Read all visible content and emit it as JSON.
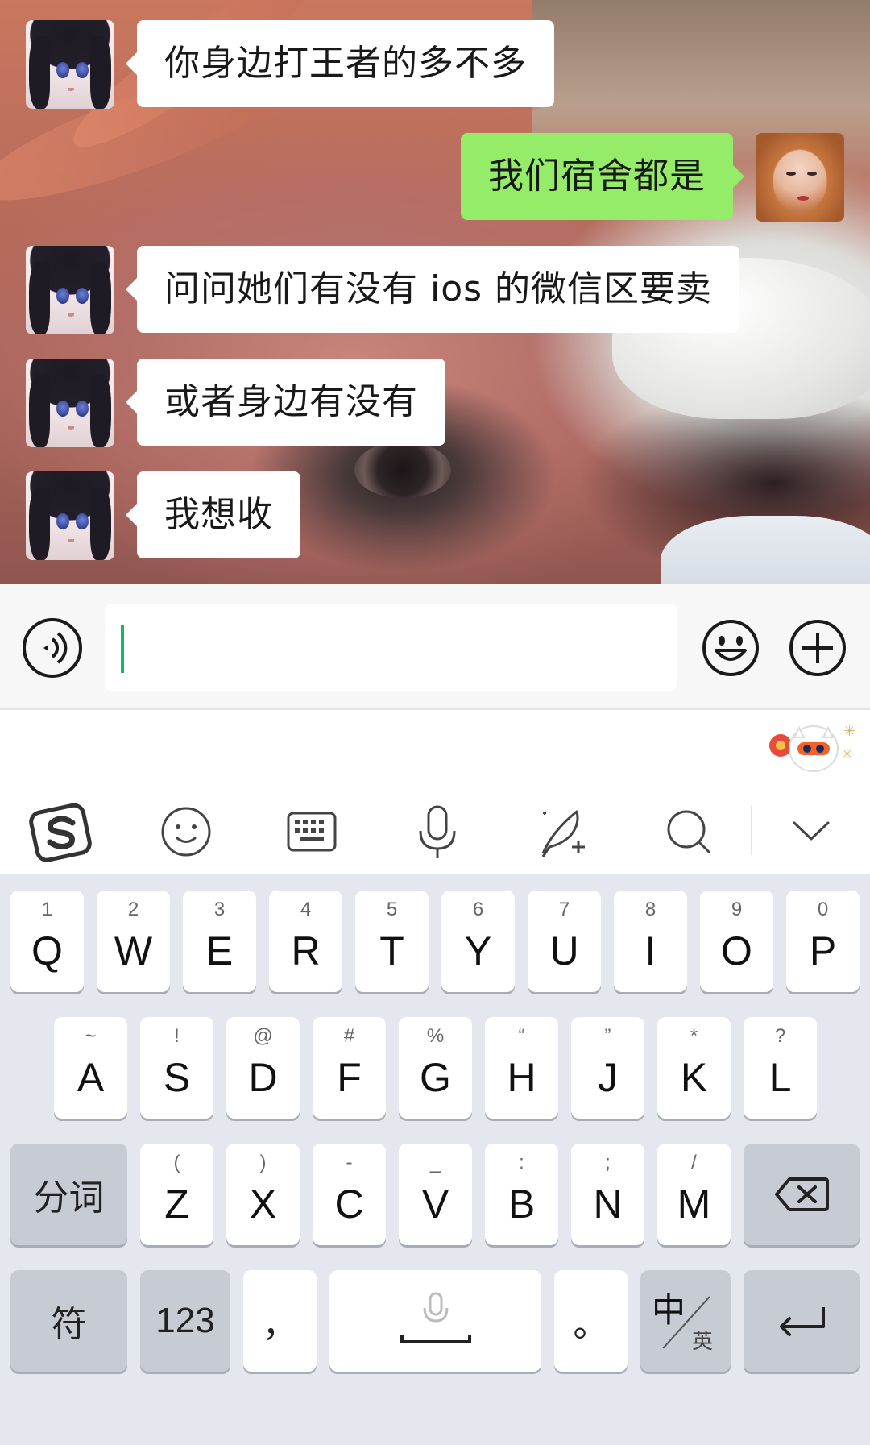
{
  "chat": {
    "messages": [
      {
        "side": "in",
        "text": "你身边打王者的多不多"
      },
      {
        "side": "out",
        "text": "我们宿舍都是"
      },
      {
        "side": "in",
        "text": "问问她们有没有 ios 的微信区要卖"
      },
      {
        "side": "in",
        "text": "或者身边有没有"
      },
      {
        "side": "in",
        "text": "我想收"
      }
    ],
    "input": {
      "value": ""
    }
  },
  "icons": {
    "voice": "voice-icon",
    "emoji": "emoji-icon",
    "plus": "plus-icon",
    "sogou": "sogou-logo-icon",
    "face": "face-icon",
    "keyboard": "keyboard-icon",
    "mic": "microphone-icon",
    "handwriting": "handwriting-icon",
    "search": "search-icon",
    "collapse": "chevron-down-icon"
  },
  "keyboard": {
    "row1": [
      {
        "sub": "1",
        "key": "Q"
      },
      {
        "sub": "2",
        "key": "W"
      },
      {
        "sub": "3",
        "key": "E"
      },
      {
        "sub": "4",
        "key": "R"
      },
      {
        "sub": "5",
        "key": "T"
      },
      {
        "sub": "6",
        "key": "Y"
      },
      {
        "sub": "7",
        "key": "U"
      },
      {
        "sub": "8",
        "key": "I"
      },
      {
        "sub": "9",
        "key": "O"
      },
      {
        "sub": "0",
        "key": "P"
      }
    ],
    "row2": [
      {
        "sub": "~",
        "key": "A"
      },
      {
        "sub": "!",
        "key": "S"
      },
      {
        "sub": "@",
        "key": "D"
      },
      {
        "sub": "#",
        "key": "F"
      },
      {
        "sub": "%",
        "key": "G"
      },
      {
        "sub": "“",
        "key": "H"
      },
      {
        "sub": "”",
        "key": "J"
      },
      {
        "sub": "*",
        "key": "K"
      },
      {
        "sub": "?",
        "key": "L"
      }
    ],
    "row3_left": "分词",
    "row3": [
      {
        "sub": "(",
        "key": "Z"
      },
      {
        "sub": ")",
        "key": "X"
      },
      {
        "sub": "-",
        "key": "C"
      },
      {
        "sub": "_",
        "key": "V"
      },
      {
        "sub": ":",
        "key": "B"
      },
      {
        "sub": ";",
        "key": "N"
      },
      {
        "sub": "/",
        "key": "M"
      }
    ],
    "symbols_label": "符",
    "numbers_label": "123",
    "comma_label": "，",
    "period_label": "。",
    "lang_main": "中",
    "lang_sub": "英"
  },
  "colors": {
    "outgoing_bubble": "#95ec69",
    "incoming_bubble": "#ffffff",
    "caret": "#07c160"
  }
}
